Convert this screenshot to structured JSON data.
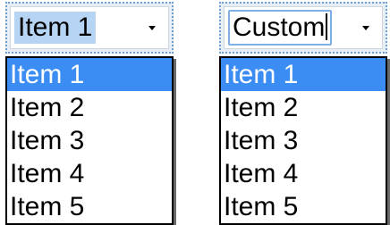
{
  "combos": [
    {
      "value": "Item 1",
      "items": [
        "Item 1",
        "Item 2",
        "Item 3",
        "Item 4",
        "Item 5"
      ],
      "selected_index": 0
    },
    {
      "value": "Custom",
      "items": [
        "Item 1",
        "Item 2",
        "Item 3",
        "Item 4",
        "Item 5"
      ],
      "selected_index": 0
    }
  ],
  "colors": {
    "selection_highlight": "#3c8df3",
    "text_selection": "#b6d4f3",
    "focus_ring": "#6f9fd0"
  },
  "icons": {
    "dropdown": "chevron-down-icon"
  }
}
